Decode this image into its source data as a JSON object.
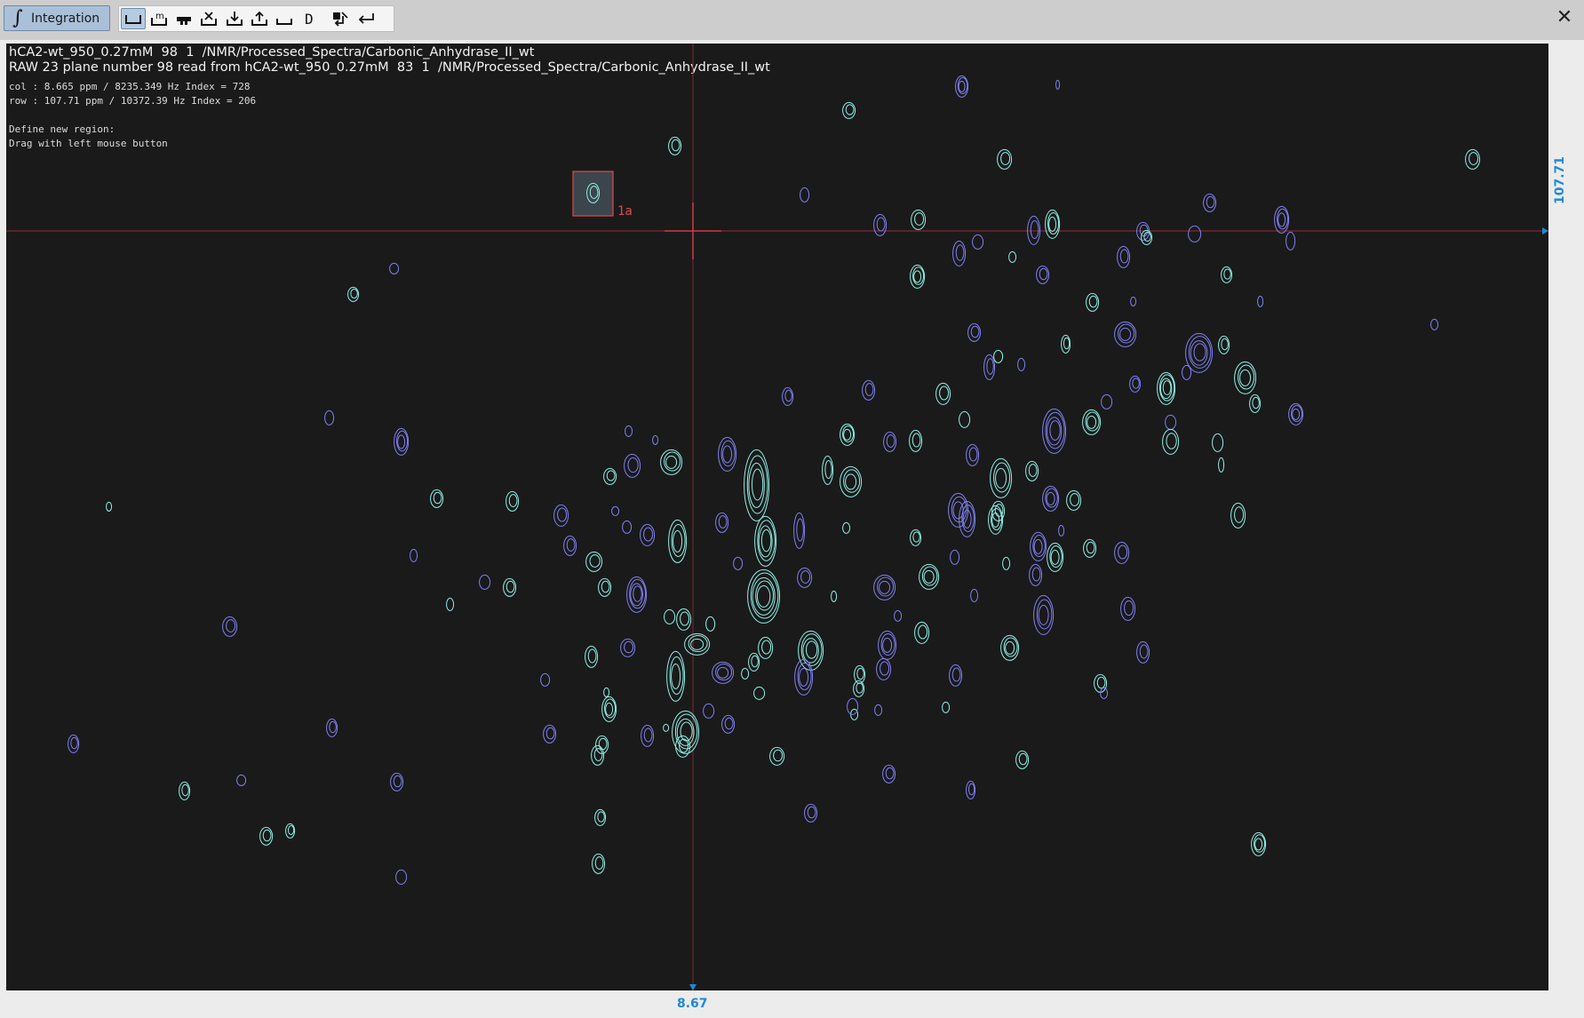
{
  "toolbar": {
    "mode_button_icon": "∫",
    "mode_button_label": "Integration",
    "tools": [
      {
        "icon": "region-icon",
        "glyph": "⎵"
      },
      {
        "icon": "manual-region-icon",
        "glyph": "m"
      },
      {
        "icon": "stamp-icon",
        "glyph": "▬"
      },
      {
        "icon": "delete-region-icon",
        "glyph": "✕"
      },
      {
        "icon": "import-icon",
        "glyph": "⤓"
      },
      {
        "icon": "export-icon",
        "glyph": "⤒"
      },
      {
        "icon": "baseline-icon",
        "glyph": "⎵"
      },
      {
        "icon": "d-icon",
        "glyph": "D"
      },
      {
        "icon": "apply-icon",
        "glyph": "⇲"
      },
      {
        "icon": "return-icon",
        "glyph": "↩"
      }
    ],
    "close_glyph": "✕"
  },
  "spectrum": {
    "header_line1": "hCA2-wt_950_0.27mM  98  1  /NMR/Processed_Spectra/Carbonic_Anhydrase_II_wt",
    "header_line2": "RAW 23 plane number 98 read from hCA2-wt_950_0.27mM  83  1  /NMR/Processed_Spectra/Carbonic_Anhydrase_II_wt",
    "col_info": "col : 8.665 ppm / 8235.349 Hz Index = 728",
    "row_info": "row : 107.71 ppm / 10372.39 Hz Index = 206",
    "instruction_title": "Define new region:",
    "instruction_text": "Drag with left mouse button",
    "cursor_x_value": "8.67",
    "cursor_y_value": "107.71",
    "region_label": "1a"
  },
  "colors": {
    "background": "#1a1a1b",
    "peak_positive": "#7f7ff0",
    "peak_cyan": "#8ef0e4",
    "cursor": "#d23a44",
    "axis_value": "#1d8ad6"
  }
}
